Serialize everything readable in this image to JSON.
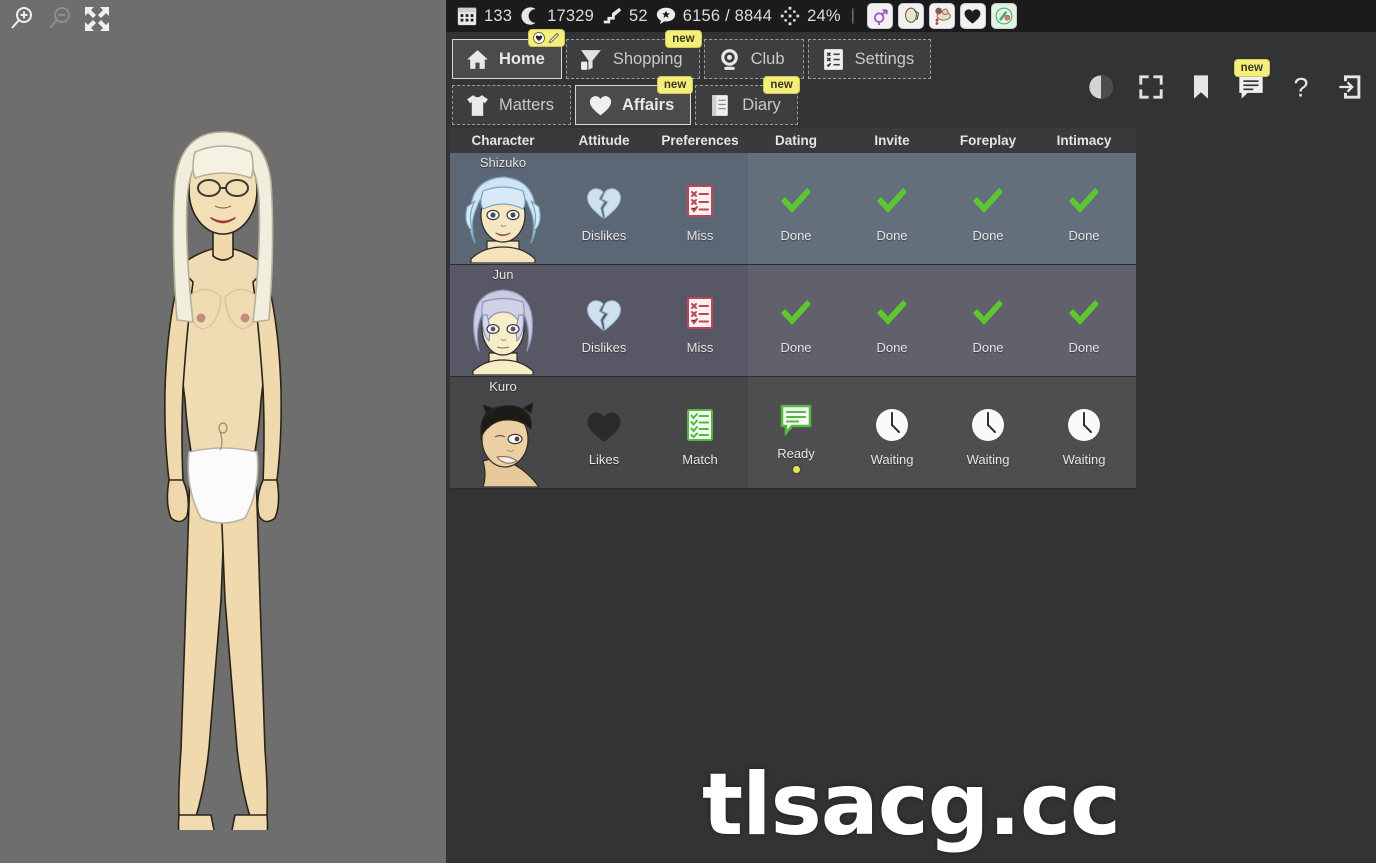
{
  "left_panel": {
    "tools": [
      {
        "name": "zoom-in-icon",
        "label": "Zoom In",
        "enabled": true
      },
      {
        "name": "zoom-out-icon",
        "label": "Zoom Out",
        "enabled": false
      },
      {
        "name": "fit-screen-icon",
        "label": "Fit To Screen",
        "enabled": true
      }
    ],
    "figure_alt": "Nude female character full-body front view, long pale blonde hair, glasses, white briefs"
  },
  "status_bar": {
    "stats": [
      {
        "icon": "calendar-icon",
        "value": "133"
      },
      {
        "icon": "coin-icon",
        "value": "17329"
      },
      {
        "icon": "stairs-icon",
        "value": "52"
      },
      {
        "icon": "star-bubble-icon",
        "value": "6156 / 8844"
      },
      {
        "icon": "move-icon",
        "value": "24%"
      }
    ],
    "separator": "|",
    "quick_icons": [
      {
        "name": "gender-icon",
        "color": "#a05fc8"
      },
      {
        "name": "glasses-icon",
        "color": "#efe3c8"
      },
      {
        "name": "lovers-icon",
        "color": "#d98a8a"
      },
      {
        "name": "heart-icon",
        "color": "#1d1d1d"
      },
      {
        "name": "pills-icon",
        "color": "#49a86a"
      }
    ]
  },
  "nav": {
    "row1": [
      {
        "label": "Home",
        "icon": "home-icon",
        "active": true,
        "badge": "icons"
      },
      {
        "label": "Shopping",
        "icon": "shopping-cart-icon",
        "active": false,
        "badge": "new"
      },
      {
        "label": "Club",
        "icon": "club-icon",
        "active": false,
        "badge": ""
      },
      {
        "label": "Settings",
        "icon": "settings-list-icon",
        "active": false,
        "badge": ""
      }
    ],
    "row2": [
      {
        "label": "Matters",
        "icon": "shirt-icon",
        "active": false,
        "badge": ""
      },
      {
        "label": "Affairs",
        "icon": "heart-icon",
        "active": true,
        "badge": "new"
      },
      {
        "label": "Diary",
        "icon": "book-icon",
        "active": false,
        "badge": "new"
      }
    ],
    "badge_new_label": "new",
    "right_icons": [
      {
        "name": "contrast-icon",
        "badge": ""
      },
      {
        "name": "fullscreen-icon",
        "badge": ""
      },
      {
        "name": "bookmark-icon",
        "badge": ""
      },
      {
        "name": "chat-icon",
        "badge": "new"
      },
      {
        "name": "help-icon",
        "badge": ""
      },
      {
        "name": "exit-icon",
        "badge": ""
      }
    ]
  },
  "table": {
    "columns": [
      "Character",
      "Attitude",
      "Preferences",
      "Dating",
      "Invite",
      "Foreplay",
      "Intimacy"
    ],
    "rows": [
      {
        "name": "Shizuko",
        "tone": "r-blue",
        "portrait": "shizuko-portrait",
        "cells": [
          {
            "icon": "broken-heart-icon",
            "label": "Dislikes",
            "dot": false
          },
          {
            "icon": "checklist-miss-icon",
            "label": "Miss",
            "dot": false
          },
          {
            "icon": "check-icon",
            "label": "Done",
            "dot": false
          },
          {
            "icon": "check-icon",
            "label": "Done",
            "dot": false
          },
          {
            "icon": "check-icon",
            "label": "Done",
            "dot": false
          },
          {
            "icon": "check-icon",
            "label": "Done",
            "dot": false
          }
        ]
      },
      {
        "name": "Jun",
        "tone": "r-purp",
        "portrait": "jun-portrait",
        "cells": [
          {
            "icon": "broken-heart-icon",
            "label": "Dislikes",
            "dot": false
          },
          {
            "icon": "checklist-miss-icon",
            "label": "Miss",
            "dot": false
          },
          {
            "icon": "check-icon",
            "label": "Done",
            "dot": false
          },
          {
            "icon": "check-icon",
            "label": "Done",
            "dot": false
          },
          {
            "icon": "check-icon",
            "label": "Done",
            "dot": false
          },
          {
            "icon": "check-icon",
            "label": "Done",
            "dot": false
          }
        ]
      },
      {
        "name": "Kuro",
        "tone": "r-gray",
        "portrait": "kuro-portrait",
        "cells": [
          {
            "icon": "heart-icon",
            "label": "Likes",
            "dot": false
          },
          {
            "icon": "checklist-match-icon",
            "label": "Match",
            "dot": false
          },
          {
            "icon": "speech-bubble-icon",
            "label": "Ready",
            "dot": true
          },
          {
            "icon": "clock-icon",
            "label": "Waiting",
            "dot": false
          },
          {
            "icon": "clock-icon",
            "label": "Waiting",
            "dot": false
          },
          {
            "icon": "clock-icon",
            "label": "Waiting",
            "dot": false
          }
        ]
      }
    ]
  },
  "watermark": {
    "text": "tlsacg.cc"
  },
  "colors": {
    "accent_green": "#5ec832",
    "badge_yellow": "#f5ef7a",
    "row_blue": "#5b6775",
    "row_purple": "#585765",
    "row_gray": "#474749",
    "panel_bg": "#333335",
    "status_bg": "#1b1b1d",
    "left_bg": "#6e6e6e"
  }
}
